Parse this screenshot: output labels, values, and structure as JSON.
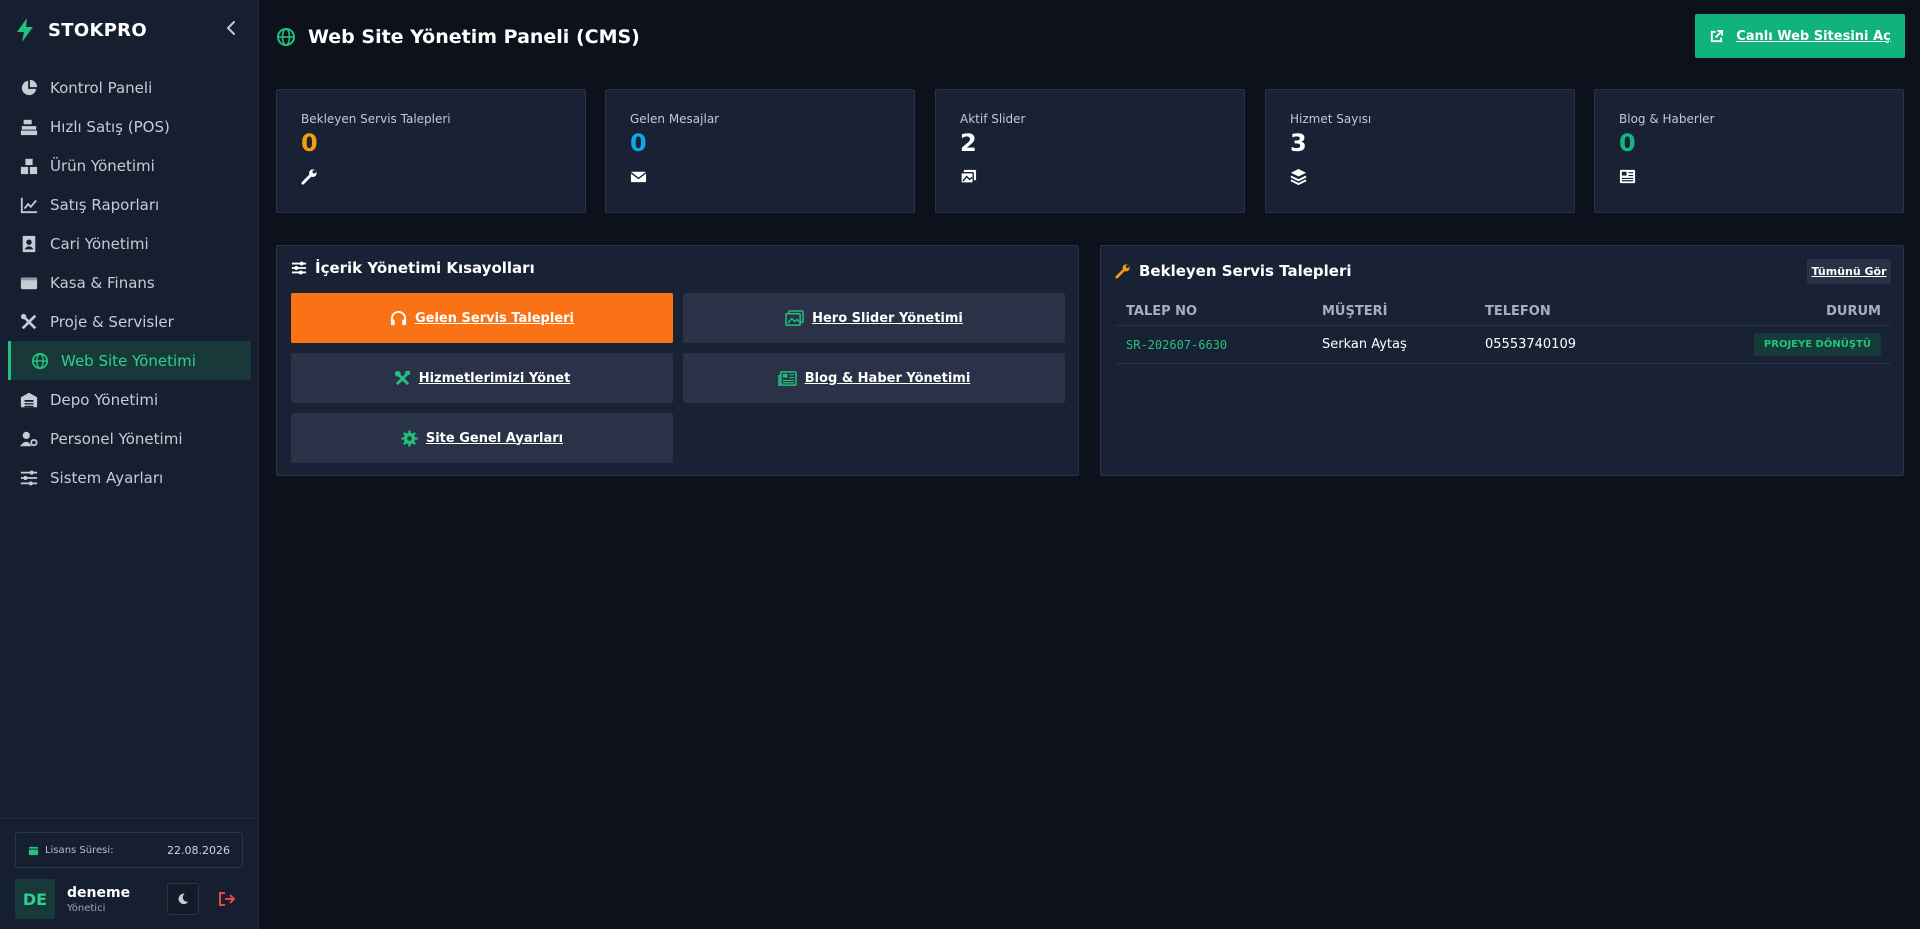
{
  "brand": {
    "name": "STOKPRO"
  },
  "sidebar": {
    "items": [
      {
        "label": "Kontrol Paneli",
        "icon": "pie-chart-icon"
      },
      {
        "label": "Hızlı Satış (POS)",
        "icon": "cash-register-icon"
      },
      {
        "label": "Ürün Yönetimi",
        "icon": "boxes-icon"
      },
      {
        "label": "Satış Raporları",
        "icon": "chart-line-icon"
      },
      {
        "label": "Cari Yönetimi",
        "icon": "address-book-icon"
      },
      {
        "label": "Kasa & Finans",
        "icon": "wallet-icon"
      },
      {
        "label": "Proje & Servisler",
        "icon": "tools-icon"
      },
      {
        "label": "Web Site Yönetimi",
        "icon": "globe-icon",
        "active": true
      },
      {
        "label": "Depo Yönetimi",
        "icon": "warehouse-icon"
      },
      {
        "label": "Personel Yönetimi",
        "icon": "user-gear-icon"
      },
      {
        "label": "Sistem Ayarları",
        "icon": "sliders-icon"
      }
    ],
    "license": {
      "label": "Lisans Süresi:",
      "date": "22.08.2026"
    },
    "user": {
      "initials": "DE",
      "name": "deneme",
      "role": "Yönetici"
    }
  },
  "header": {
    "title": "Web Site Yönetim Paneli (CMS)",
    "live_button": "Canlı Web Sitesini Aç"
  },
  "stats": [
    {
      "label": "Bekleyen Servis Talepleri",
      "value": "0",
      "color": "#f59e0b",
      "icon": "wrench-icon"
    },
    {
      "label": "Gelen Mesajlar",
      "value": "0",
      "color": "#0ea5e9",
      "icon": "envelope-icon"
    },
    {
      "label": "Aktif Slider",
      "value": "2",
      "color": "#ffffff",
      "icon": "images-icon"
    },
    {
      "label": "Hizmet Sayısı",
      "value": "3",
      "color": "#ffffff",
      "icon": "layers-icon"
    },
    {
      "label": "Blog & Haberler",
      "value": "0",
      "color": "#10b981",
      "icon": "newspaper-icon"
    }
  ],
  "shortcuts": {
    "title": "İçerik Yönetimi Kısayolları",
    "items": [
      {
        "label": "Gelen Servis Talepleri",
        "icon": "headset-icon"
      },
      {
        "label": "Hero Slider Yönetimi",
        "icon": "images-icon"
      },
      {
        "label": "Hizmetlerimizi Yönet",
        "icon": "tools-icon"
      },
      {
        "label": "Blog & Haber Yönetimi",
        "icon": "newspaper-icon"
      },
      {
        "label": "Site Genel Ayarları",
        "icon": "gear-icon"
      }
    ]
  },
  "requests": {
    "title": "Bekleyen Servis Talepleri",
    "see_all": "Tümünü Gör",
    "columns": [
      "TALEP NO",
      "MÜŞTERİ",
      "TELEFON",
      "DURUM"
    ],
    "rows": [
      {
        "no": "SR-202607-6630",
        "customer": "Serkan Aytaş",
        "phone": "05553740109",
        "status": "PROJEYE DÖNÜŞTÜ"
      }
    ]
  },
  "colors": {
    "accent_green": "#10b37b",
    "accent_orange": "#f97316",
    "danger_red": "#ef4444"
  }
}
